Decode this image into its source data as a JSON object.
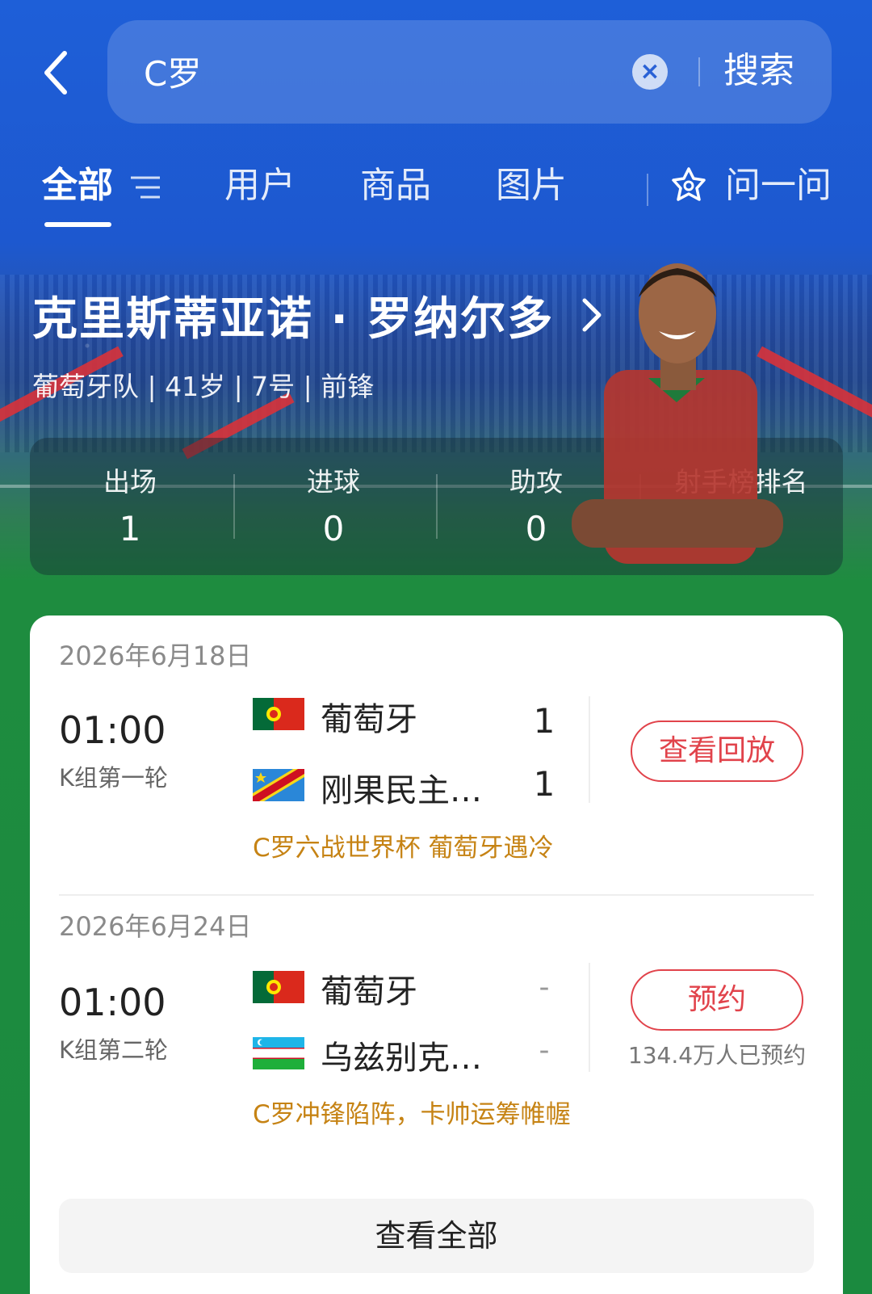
{
  "header": {
    "search_value": "C罗",
    "search_button": "搜索"
  },
  "tabs": [
    {
      "label": "全部"
    },
    {
      "label": "用户"
    },
    {
      "label": "商品"
    },
    {
      "label": "图片"
    },
    {
      "label": "问一问"
    }
  ],
  "player": {
    "name": "克里斯蒂亚诺 · 罗纳尔多",
    "meta": "葡萄牙队 | 41岁 | 7号 | 前锋",
    "stats": [
      {
        "label": "出场",
        "value": "1"
      },
      {
        "label": "进球",
        "value": "0"
      },
      {
        "label": "助攻",
        "value": "0"
      },
      {
        "label": "射手榜排名",
        "value": "–"
      }
    ]
  },
  "matches": [
    {
      "date": "2026年6月18日",
      "time": "01:00",
      "round": "K组第一轮",
      "home": {
        "name": "葡萄牙",
        "score": "1"
      },
      "away": {
        "name": "刚果民主…",
        "score": "1"
      },
      "action": "查看回放",
      "headline": "C罗六战世界杯 葡萄牙遇冷"
    },
    {
      "date": "2026年6月24日",
      "time": "01:00",
      "round": "K组第二轮",
      "home": {
        "name": "葡萄牙",
        "score": "-"
      },
      "away": {
        "name": "乌兹别克…",
        "score": "-"
      },
      "action": "预约",
      "reserve_count": "134.4万人已预约",
      "headline": "C罗冲锋陷阵，卡帅运筹帷幄"
    }
  ],
  "view_all": "查看全部",
  "colors": {
    "accent_red": "#e1434b",
    "headline_gold": "#c68314",
    "header_blue": "#1e5fd8",
    "pitch_green": "#1b8a3f"
  },
  "icons": [
    "back-icon",
    "clear-icon",
    "filter-icon",
    "ask-ai-icon",
    "chevron-right-icon",
    "portugal-flag-icon",
    "dr-congo-flag-icon",
    "uzbekistan-flag-icon"
  ]
}
